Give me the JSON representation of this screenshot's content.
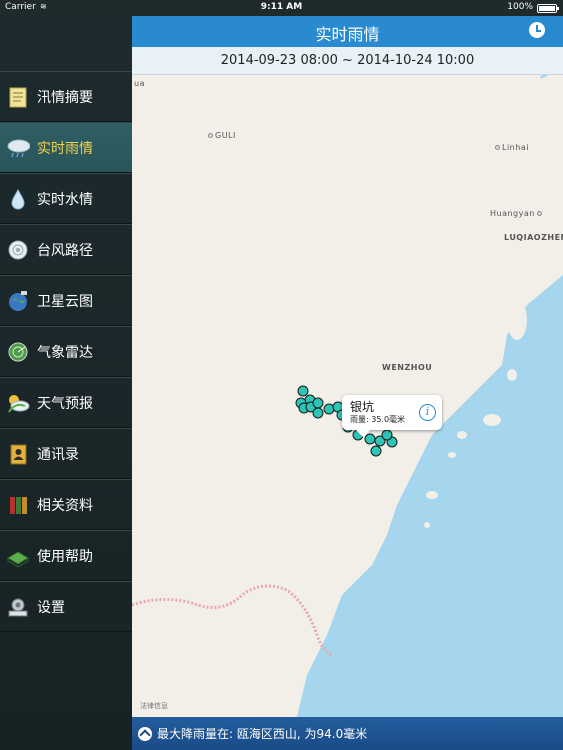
{
  "status_bar": {
    "carrier": "Carrier",
    "time": "9:11 AM",
    "battery": "100%"
  },
  "header": {
    "title": "实时雨情",
    "clock_icon": "clock-icon"
  },
  "date_range": "2014-09-23 08:00 ~ 2014-10-24 10:00",
  "sidebar": {
    "items": [
      {
        "label": "汛情摘要",
        "icon": "notes-icon",
        "active": false
      },
      {
        "label": "实时雨情",
        "icon": "rain-cloud-icon",
        "active": true
      },
      {
        "label": "实时水情",
        "icon": "water-drops-icon",
        "active": false
      },
      {
        "label": "台风路径",
        "icon": "typhoon-icon",
        "active": false
      },
      {
        "label": "卫星云图",
        "icon": "satellite-icon",
        "active": false
      },
      {
        "label": "气象雷达",
        "icon": "radar-icon",
        "active": false
      },
      {
        "label": "天气预报",
        "icon": "weather-icon",
        "active": false
      },
      {
        "label": "通讯录",
        "icon": "contacts-icon",
        "active": false
      },
      {
        "label": "相关资料",
        "icon": "books-icon",
        "active": false
      },
      {
        "label": "使用帮助",
        "icon": "help-book-icon",
        "active": false
      },
      {
        "label": "设置",
        "icon": "settings-icon",
        "active": false
      }
    ]
  },
  "map": {
    "places": [
      "ua",
      "GULI",
      "Linhai",
      "Huangyan",
      "LUQIAOZHEN",
      "WENZHOU"
    ],
    "legal": "法律信息",
    "callout": {
      "name": "银坑",
      "value": "雨量: 35.0毫米"
    },
    "marker_color": "#2ec4b6"
  },
  "bottom_bar": {
    "text": "最大降雨量在: 瓯海区西山, 为94.0毫米"
  }
}
